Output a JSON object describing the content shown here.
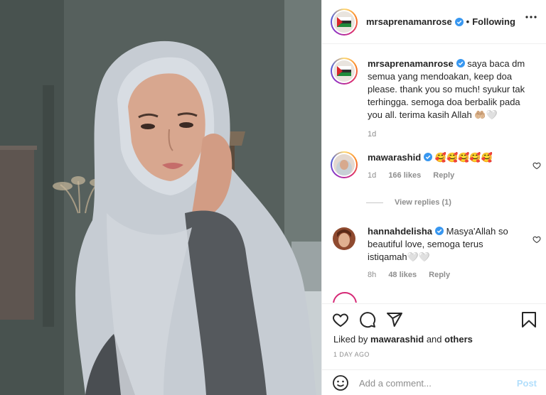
{
  "post": {
    "author": "mrsaprenamanrose",
    "follow_status": "Following",
    "separator": "•",
    "caption": {
      "text": "saya baca dm semua yang mendoakan, keep doa please. thank you so much! syukur tak terhingga. semoga doa berbalik pada you all. terima kasih Allah 🤲🏼🤍",
      "time": "1d"
    },
    "comments": [
      {
        "user": "mawarashid",
        "text": "🥰🥰🥰🥰🥰",
        "time": "1d",
        "likes": "166 likes",
        "reply": "Reply",
        "view_replies": "View replies (1)"
      },
      {
        "user": "hannahdelisha",
        "text": "Masya'Allah so beautiful love, semoga terus istiqamah🤍🤍",
        "time": "8h",
        "likes": "48 likes",
        "reply": "Reply"
      }
    ],
    "liked_by": {
      "prefix": "Liked by",
      "user": "mawarashid",
      "conj": "and",
      "others": "others"
    },
    "timestamp": "1 DAY AGO",
    "add_comment_placeholder": "Add a comment...",
    "post_label": "Post"
  },
  "colors": {
    "verified": "#3897f0",
    "muted": "#8e8e8e",
    "post_button": "#b2dffc",
    "text": "#262626"
  },
  "icons": {
    "more": "more-horizontal-icon",
    "like": "heart-icon",
    "comment": "comment-icon",
    "share": "paper-plane-icon",
    "save": "bookmark-icon",
    "emoji": "smiley-icon",
    "verified": "verified-badge-icon"
  }
}
